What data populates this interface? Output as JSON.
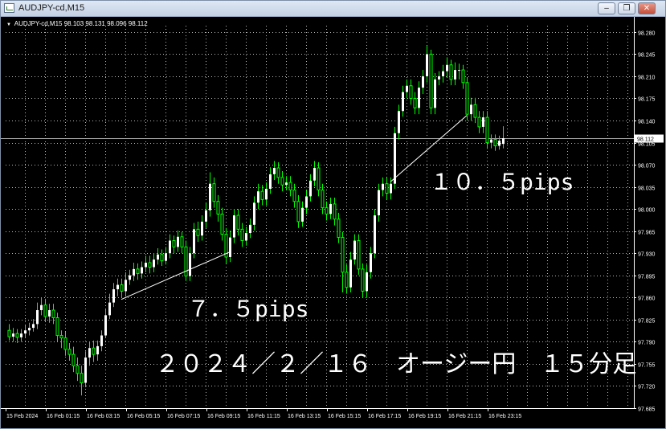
{
  "window": {
    "title": "AUDJPY-cd,M15",
    "buttons": {
      "minimize": "–",
      "restore": "❐",
      "close": "✕"
    }
  },
  "chart_info": {
    "indicator": "▼",
    "symbol_text": "AUDJPY-cd,M15",
    "ohlc_text": "98.103 98.131 98.096 98.112"
  },
  "current_price": "98.112",
  "annotations": {
    "move1": "７．５pips",
    "move2": "１０．５pips",
    "caption": "２０２４／２／１６　オージー円　１５分足"
  },
  "colors": {
    "background": "#000000",
    "grid": "#b8b8b8",
    "bull_candle": "#ffffff",
    "candle_wick": "#00ff00",
    "bear_candle": "#000000",
    "axis_text": "#ffffff",
    "price_line": "#aaaaaa"
  },
  "chart_data": {
    "type": "candlestick",
    "y_ticks": [
      "98.280",
      "98.245",
      "98.210",
      "98.175",
      "98.140",
      "98.105",
      "98.070",
      "98.035",
      "98.000",
      "97.965",
      "97.930",
      "97.895",
      "97.860",
      "97.825",
      "97.790",
      "97.755",
      "97.720",
      "97.685"
    ],
    "ylim": [
      97.685,
      98.29
    ],
    "x_ticks": [
      "15 Feb 2024",
      "16 Feb 01:15",
      "16 Feb 03:15",
      "16 Feb 05:15",
      "16 Feb 07:15",
      "16 Feb 09:15",
      "16 Feb 11:15",
      "16 Feb 13:15",
      "16 Feb 15:15",
      "16 Feb 17:15",
      "16 Feb 19:15",
      "16 Feb 21:15",
      "16 Feb 23:15"
    ],
    "grid": true,
    "trend_lines": [
      {
        "from_index": 28,
        "from_price": 97.857,
        "to_index": 55,
        "to_price": 97.932,
        "label": "７．５pips"
      },
      {
        "from_index": 95,
        "from_price": 98.043,
        "to_index": 114,
        "to_price": 98.148,
        "label": "１０．５pips"
      }
    ],
    "candles": [
      [
        97.808,
        97.798,
        97.818,
        97.792
      ],
      [
        97.798,
        97.803,
        97.812,
        97.79
      ],
      [
        97.803,
        97.797,
        97.81,
        97.788
      ],
      [
        97.797,
        97.803,
        97.81,
        97.79
      ],
      [
        97.803,
        97.808,
        97.816,
        97.796
      ],
      [
        97.808,
        97.812,
        97.82,
        97.8
      ],
      [
        97.812,
        97.818,
        97.826,
        97.806
      ],
      [
        97.818,
        97.84,
        97.852,
        97.81
      ],
      [
        97.84,
        97.848,
        97.86,
        97.832
      ],
      [
        97.848,
        97.83,
        97.858,
        97.822
      ],
      [
        97.83,
        97.84,
        97.85,
        97.82
      ],
      [
        97.84,
        97.828,
        97.85,
        97.818
      ],
      [
        97.828,
        97.8,
        97.836,
        97.79
      ],
      [
        97.8,
        97.796,
        97.808,
        97.78
      ],
      [
        97.796,
        97.778,
        97.806,
        97.768
      ],
      [
        97.778,
        97.77,
        97.788,
        97.76
      ],
      [
        97.77,
        97.752,
        97.782,
        97.742
      ],
      [
        97.752,
        97.74,
        97.765,
        97.728
      ],
      [
        97.74,
        97.725,
        97.752,
        97.705
      ],
      [
        97.725,
        97.765,
        97.775,
        97.718
      ],
      [
        97.765,
        97.78,
        97.79,
        97.752
      ],
      [
        97.78,
        97.77,
        97.792,
        97.758
      ],
      [
        97.77,
        97.783,
        97.792,
        97.76
      ],
      [
        97.783,
        97.8,
        97.808,
        97.775
      ],
      [
        97.8,
        97.832,
        97.842,
        97.796
      ],
      [
        97.832,
        97.852,
        97.866,
        97.826
      ],
      [
        97.852,
        97.873,
        97.883,
        97.845
      ],
      [
        97.873,
        97.88,
        97.89,
        97.862
      ],
      [
        97.88,
        97.87,
        97.89,
        97.86
      ],
      [
        97.87,
        97.888,
        97.9,
        97.862
      ],
      [
        97.888,
        97.895,
        97.904,
        97.88
      ],
      [
        97.895,
        97.905,
        97.915,
        97.886
      ],
      [
        97.905,
        97.898,
        97.914,
        97.888
      ],
      [
        97.898,
        97.908,
        97.917,
        97.89
      ],
      [
        97.908,
        97.915,
        97.926,
        97.9
      ],
      [
        97.915,
        97.908,
        97.926,
        97.898
      ],
      [
        97.908,
        97.92,
        97.93,
        97.9
      ],
      [
        97.92,
        97.928,
        97.938,
        97.912
      ],
      [
        97.928,
        97.918,
        97.936,
        97.91
      ],
      [
        97.918,
        97.93,
        97.94,
        97.912
      ],
      [
        97.93,
        97.95,
        97.96,
        97.922
      ],
      [
        97.95,
        97.94,
        97.958,
        97.93
      ],
      [
        97.94,
        97.956,
        97.966,
        97.932
      ],
      [
        97.956,
        97.94,
        97.964,
        97.93
      ],
      [
        97.94,
        97.894,
        97.95,
        97.886
      ],
      [
        97.894,
        97.93,
        97.94,
        97.886
      ],
      [
        97.93,
        97.968,
        97.978,
        97.922
      ],
      [
        97.968,
        97.958,
        97.98,
        97.948
      ],
      [
        97.958,
        97.98,
        97.99,
        97.95
      ],
      [
        97.98,
        97.998,
        98.01,
        97.97
      ],
      [
        97.998,
        98.04,
        98.058,
        97.988
      ],
      [
        98.04,
        98.012,
        98.05,
        98.002
      ],
      [
        98.012,
        97.992,
        98.022,
        97.98
      ],
      [
        97.992,
        97.96,
        98.002,
        97.95
      ],
      [
        97.96,
        97.924,
        97.97,
        97.914
      ],
      [
        97.924,
        97.955,
        97.966,
        97.916
      ],
      [
        97.955,
        97.99,
        98.0,
        97.946
      ],
      [
        97.99,
        97.968,
        98.0,
        97.958
      ],
      [
        97.968,
        97.95,
        97.978,
        97.94
      ],
      [
        97.95,
        97.962,
        97.972,
        97.942
      ],
      [
        97.962,
        97.975,
        97.985,
        97.954
      ],
      [
        97.975,
        98.01,
        98.02,
        97.966
      ],
      [
        98.01,
        98.028,
        98.04,
        98.0
      ],
      [
        98.028,
        98.015,
        98.038,
        98.006
      ],
      [
        98.015,
        98.032,
        98.042,
        98.006
      ],
      [
        98.032,
        98.055,
        98.066,
        98.024
      ],
      [
        98.055,
        98.065,
        98.076,
        98.046
      ],
      [
        98.065,
        98.05,
        98.074,
        98.04
      ],
      [
        98.05,
        98.038,
        98.06,
        98.028
      ],
      [
        98.038,
        98.042,
        98.052,
        98.03
      ],
      [
        98.042,
        98.03,
        98.052,
        98.02
      ],
      [
        98.03,
        98.012,
        98.04,
        98.002
      ],
      [
        98.012,
        97.98,
        98.022,
        97.97
      ],
      [
        97.98,
        98.002,
        98.012,
        97.972
      ],
      [
        98.002,
        98.02,
        98.03,
        97.992
      ],
      [
        98.02,
        98.045,
        98.055,
        98.012
      ],
      [
        98.045,
        98.065,
        98.076,
        98.036
      ],
      [
        98.065,
        98.03,
        98.074,
        98.02
      ],
      [
        98.03,
        98.002,
        98.04,
        97.992
      ],
      [
        98.002,
        97.992,
        98.012,
        97.982
      ],
      [
        97.992,
        98.008,
        98.018,
        97.984
      ],
      [
        98.008,
        97.984,
        98.018,
        97.974
      ],
      [
        97.984,
        97.955,
        97.994,
        97.946
      ],
      [
        97.955,
        97.9,
        97.964,
        97.868
      ],
      [
        97.9,
        97.876,
        97.912,
        97.866
      ],
      [
        97.876,
        97.92,
        97.932,
        97.868
      ],
      [
        97.92,
        97.95,
        97.96,
        97.912
      ],
      [
        97.95,
        97.905,
        97.96,
        97.896
      ],
      [
        97.905,
        97.87,
        97.914,
        97.86
      ],
      [
        97.87,
        97.9,
        97.912,
        97.86
      ],
      [
        97.9,
        97.93,
        97.94,
        97.89
      ],
      [
        97.93,
        97.99,
        98.0,
        97.922
      ],
      [
        97.99,
        98.03,
        98.04,
        97.98
      ],
      [
        98.03,
        98.04,
        98.05,
        98.02
      ],
      [
        98.04,
        98.025,
        98.05,
        98.015
      ],
      [
        98.025,
        98.04,
        98.05,
        98.015
      ],
      [
        98.04,
        98.12,
        98.13,
        98.032
      ],
      [
        98.12,
        98.155,
        98.165,
        98.11
      ],
      [
        98.155,
        98.185,
        98.195,
        98.146
      ],
      [
        98.185,
        98.195,
        98.205,
        98.175
      ],
      [
        98.195,
        98.175,
        98.205,
        98.165
      ],
      [
        98.175,
        98.16,
        98.185,
        98.15
      ],
      [
        98.16,
        98.192,
        98.202,
        98.15
      ],
      [
        98.192,
        98.21,
        98.22,
        98.182
      ],
      [
        98.21,
        98.245,
        98.258,
        98.2
      ],
      [
        98.245,
        98.16,
        98.252,
        98.15
      ],
      [
        98.16,
        98.205,
        98.215,
        98.15
      ],
      [
        98.205,
        98.21,
        98.218,
        98.196
      ],
      [
        98.21,
        98.218,
        98.228,
        98.2
      ],
      [
        98.218,
        98.228,
        98.24,
        98.208
      ],
      [
        98.228,
        98.205,
        98.236,
        98.196
      ],
      [
        98.205,
        98.22,
        98.232,
        98.196
      ],
      [
        98.22,
        98.22,
        98.23,
        98.205
      ],
      [
        98.22,
        98.2,
        98.228,
        98.19
      ],
      [
        98.2,
        98.15,
        98.208,
        98.14
      ],
      [
        98.15,
        98.165,
        98.176,
        98.14
      ],
      [
        98.165,
        98.145,
        98.176,
        98.136
      ],
      [
        98.145,
        98.13,
        98.155,
        98.12
      ],
      [
        98.13,
        98.145,
        98.155,
        98.12
      ],
      [
        98.145,
        98.105,
        98.155,
        98.095
      ],
      [
        98.105,
        98.11,
        98.118,
        98.096
      ],
      [
        98.11,
        98.1,
        98.118,
        98.092
      ],
      [
        98.1,
        98.108,
        98.116,
        98.094
      ],
      [
        98.103,
        98.112,
        98.131,
        98.096
      ]
    ]
  }
}
